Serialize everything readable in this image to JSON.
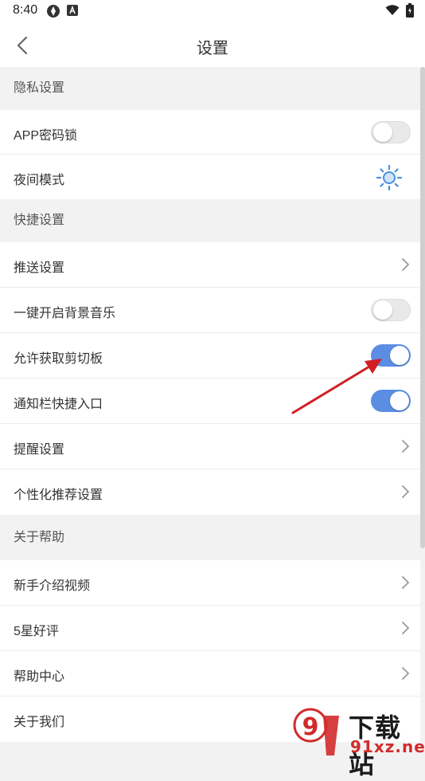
{
  "status_bar": {
    "time": "8:40",
    "icons": [
      "app-badge-icon",
      "a-square-icon",
      "wifi-icon",
      "battery-icon"
    ]
  },
  "nav": {
    "title": "设置",
    "back_icon": "chevron-left-icon"
  },
  "sections": {
    "privacy": {
      "header": "隐私设置",
      "app_lock": {
        "label": "APP密码锁",
        "toggle": "off"
      },
      "night_mode": {
        "label": "夜间模式",
        "icon": "sun-icon"
      }
    },
    "shortcuts": {
      "header": "快捷设置",
      "push": {
        "label": "推送设置"
      },
      "bg_music": {
        "label": "一键开启背景音乐",
        "toggle": "off"
      },
      "clipboard": {
        "label": "允许获取剪切板",
        "toggle": "on"
      },
      "notif_shortcut": {
        "label": "通知栏快捷入口",
        "toggle": "on"
      },
      "reminder": {
        "label": "提醒设置"
      },
      "recommend": {
        "label": "个性化推荐设置"
      }
    },
    "help": {
      "header": "关于帮助",
      "intro_video": {
        "label": "新手介绍视频"
      },
      "rating": {
        "label": "5星好评"
      },
      "help_center": {
        "label": "帮助中心"
      },
      "about": {
        "label": "关于我们"
      }
    }
  },
  "watermark": {
    "brand": "下载站",
    "site": "91xz.net"
  },
  "colors": {
    "toggle_on": "#5b8ee3",
    "toggle_off": "#e9e9e9",
    "sun": "#4a90d9",
    "arrow": "#d11f26",
    "background": "#f2f2f2"
  }
}
